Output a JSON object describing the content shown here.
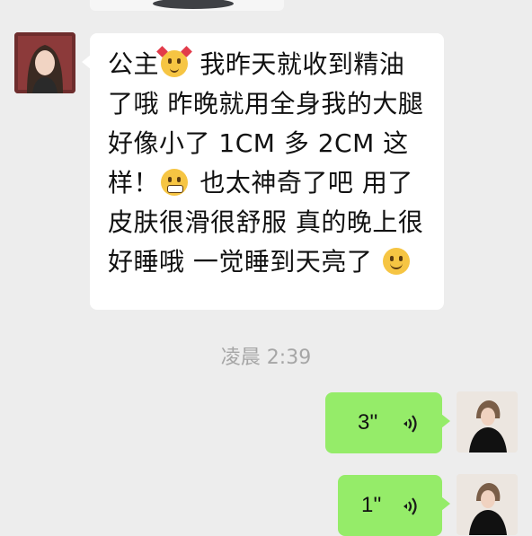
{
  "chat": {
    "incoming": {
      "segments": [
        "公主",
        "我昨天就收到精油了哦 昨晚就用全身我的大腿好像小了 1CM 多 2CM 这样！",
        "也太神奇了吧 用了皮肤很滑很舒服 真的晚上很好睡哦 一觉睡到天亮了"
      ],
      "emojis": [
        "smiling-face-with-hearts",
        "grimacing-face",
        "smiling-face"
      ]
    },
    "timestamp": "凌晨 2:39",
    "voice_messages": [
      {
        "duration": "3''"
      },
      {
        "duration": "1''"
      }
    ]
  },
  "colors": {
    "background": "#ededed",
    "incoming_bubble": "#ffffff",
    "outgoing_bubble": "#95ec69",
    "timestamp": "#a6a6a6"
  }
}
